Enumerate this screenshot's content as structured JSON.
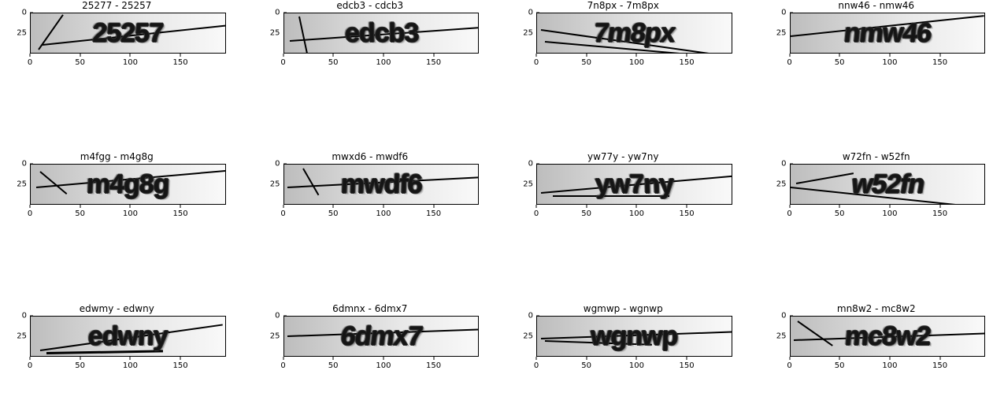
{
  "chart_data": [
    {
      "title": "25277 - 25257",
      "image_text": "25257",
      "xticks": [
        0,
        50,
        100,
        150
      ],
      "yticks": [
        0,
        25
      ],
      "xlim": [
        0,
        195
      ],
      "ylim": [
        50,
        0
      ]
    },
    {
      "title": "edcb3 - cdcb3",
      "image_text": "edcb3",
      "xticks": [
        0,
        50,
        100,
        150
      ],
      "yticks": [
        0,
        25
      ],
      "xlim": [
        0,
        195
      ],
      "ylim": [
        50,
        0
      ]
    },
    {
      "title": "7n8px - 7m8px",
      "image_text": "7m8px",
      "xticks": [
        0,
        50,
        100,
        150
      ],
      "yticks": [
        0,
        25
      ],
      "xlim": [
        0,
        195
      ],
      "ylim": [
        50,
        0
      ]
    },
    {
      "title": "nnw46 - nmw46",
      "image_text": "nmw46",
      "xticks": [
        0,
        50,
        100,
        150
      ],
      "yticks": [
        0,
        25
      ],
      "xlim": [
        0,
        195
      ],
      "ylim": [
        50,
        0
      ]
    },
    {
      "title": "m4fgg - m4g8g",
      "image_text": "m4g8g",
      "xticks": [
        0,
        50,
        100,
        150
      ],
      "yticks": [
        0,
        25
      ],
      "xlim": [
        0,
        195
      ],
      "ylim": [
        50,
        0
      ]
    },
    {
      "title": "mwxd6 - mwdf6",
      "image_text": "mwdf6",
      "xticks": [
        0,
        50,
        100,
        150
      ],
      "yticks": [
        0,
        25
      ],
      "xlim": [
        0,
        195
      ],
      "ylim": [
        50,
        0
      ]
    },
    {
      "title": "yw77y - yw7ny",
      "image_text": "yw7ny",
      "xticks": [
        0,
        50,
        100,
        150
      ],
      "yticks": [
        0,
        25
      ],
      "xlim": [
        0,
        195
      ],
      "ylim": [
        50,
        0
      ]
    },
    {
      "title": "w72fn - w52fn",
      "image_text": "w52fn",
      "xticks": [
        0,
        50,
        100,
        150
      ],
      "yticks": [
        0,
        25
      ],
      "xlim": [
        0,
        195
      ],
      "ylim": [
        50,
        0
      ]
    },
    {
      "title": "edwmy - edwny",
      "image_text": "edwny",
      "xticks": [
        0,
        50,
        100,
        150
      ],
      "yticks": [
        0,
        25
      ],
      "xlim": [
        0,
        195
      ],
      "ylim": [
        50,
        0
      ]
    },
    {
      "title": "6dmnx - 6dmx7",
      "image_text": "6dmx7",
      "xticks": [
        0,
        50,
        100,
        150
      ],
      "yticks": [
        0,
        25
      ],
      "xlim": [
        0,
        195
      ],
      "ylim": [
        50,
        0
      ]
    },
    {
      "title": "wgmwp - wgnwp",
      "image_text": "wgnwp",
      "xticks": [
        0,
        50,
        100,
        150
      ],
      "yticks": [
        0,
        25
      ],
      "xlim": [
        0,
        195
      ],
      "ylim": [
        50,
        0
      ]
    },
    {
      "title": "mn8w2 - mc8w2",
      "image_text": "mc8w2",
      "xticks": [
        0,
        50,
        100,
        150
      ],
      "yticks": [
        0,
        25
      ],
      "xlim": [
        0,
        195
      ],
      "ylim": [
        50,
        0
      ]
    }
  ]
}
